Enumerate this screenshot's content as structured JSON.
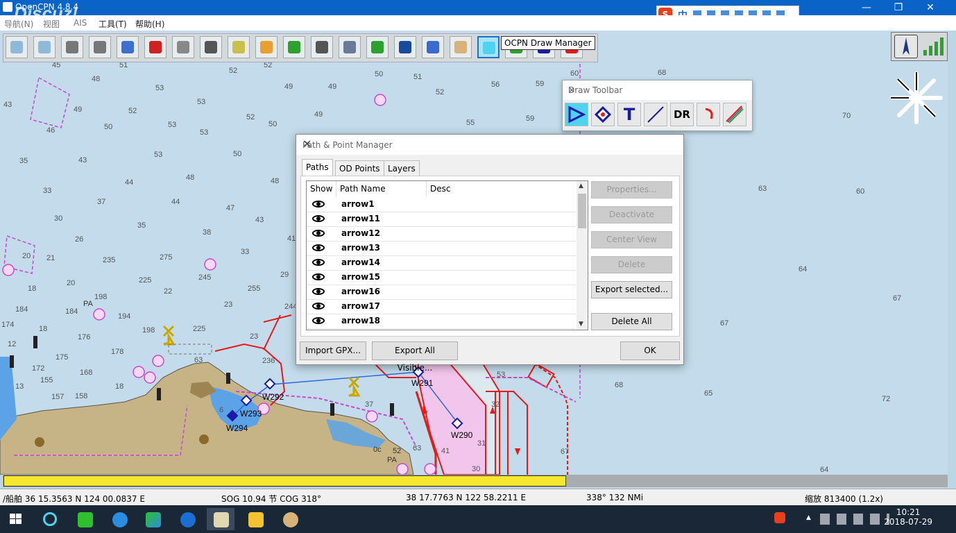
{
  "window": {
    "title": "OpenCPN 4.8.4",
    "watermark": "Discuz!",
    "min_glyph": "—",
    "max_glyph": "❐",
    "close_glyph": "✕"
  },
  "menu": [
    "导航(N)",
    "视图",
    "AIS",
    "工具(T)",
    "帮助(H)"
  ],
  "ime": {
    "logo": "S",
    "lang": "中"
  },
  "tooltip": "OCPN Draw Manager",
  "map_depths": [
    [
      "45",
      75,
      88
    ],
    [
      "51",
      172,
      88
    ],
    [
      "52",
      330,
      96
    ],
    [
      "52",
      380,
      88
    ],
    [
      "50",
      540,
      101
    ],
    [
      "51",
      596,
      105
    ],
    [
      "60",
      822,
      100
    ],
    [
      "68",
      948,
      99
    ],
    [
      "48",
      132,
      108
    ],
    [
      "53",
      224,
      121
    ],
    [
      "49",
      410,
      119
    ],
    [
      "49",
      473,
      119
    ],
    [
      "52",
      628,
      127
    ],
    [
      "56",
      708,
      116
    ],
    [
      "59",
      772,
      115
    ],
    [
      "43",
      5,
      145
    ],
    [
      "49",
      106,
      152
    ],
    [
      "53",
      284,
      141
    ],
    [
      "52",
      185,
      154
    ],
    [
      "52",
      355,
      163
    ],
    [
      "49",
      453,
      159
    ],
    [
      "50",
      387,
      173
    ],
    [
      "50",
      150,
      177
    ],
    [
      "53",
      242,
      174
    ],
    [
      "46",
      67,
      182
    ],
    [
      "53",
      288,
      185
    ],
    [
      "55",
      672,
      171
    ],
    [
      "59",
      758,
      165
    ],
    [
      "70",
      1214,
      161
    ],
    [
      "35",
      28,
      226
    ],
    [
      "43",
      113,
      225
    ],
    [
      "53",
      222,
      217
    ],
    [
      "50",
      336,
      216
    ],
    [
      "44",
      180,
      257
    ],
    [
      "48",
      268,
      250
    ],
    [
      "48",
      390,
      255
    ],
    [
      "33",
      62,
      269
    ],
    [
      "37",
      140,
      285
    ],
    [
      "44",
      247,
      285
    ],
    [
      "47",
      326,
      294
    ],
    [
      "63",
      1093,
      266
    ],
    [
      "60",
      1234,
      270
    ],
    [
      "30",
      78,
      309
    ],
    [
      "35",
      198,
      319
    ],
    [
      "43",
      368,
      311
    ],
    [
      "38",
      292,
      329
    ],
    [
      "41",
      414,
      338
    ],
    [
      "26",
      108,
      339
    ],
    [
      "20",
      32,
      363
    ],
    [
      "21",
      67,
      366
    ],
    [
      "235",
      148,
      369
    ],
    [
      "275",
      230,
      365
    ],
    [
      "33",
      347,
      357
    ],
    [
      "64",
      1151,
      382
    ],
    [
      "20",
      96,
      402
    ],
    [
      "225",
      200,
      398
    ],
    [
      "245",
      286,
      394
    ],
    [
      "29",
      404,
      390
    ],
    [
      "18",
      40,
      410
    ],
    [
      "22",
      236,
      414
    ],
    [
      "255",
      357,
      410
    ],
    [
      "198",
      136,
      422
    ],
    [
      "23",
      323,
      433
    ],
    [
      "244",
      410,
      436
    ],
    [
      "67",
      1287,
      424
    ],
    [
      "184",
      22,
      440
    ],
    [
      "184",
      94,
      443
    ],
    [
      "194",
      170,
      450
    ],
    [
      "198",
      205,
      470
    ],
    [
      "225",
      278,
      468
    ],
    [
      "174",
      2,
      462
    ],
    [
      "18",
      56,
      468
    ],
    [
      "176",
      112,
      480
    ],
    [
      "23",
      360,
      479
    ],
    [
      "67",
      1038,
      460
    ],
    [
      "12",
      11,
      490
    ],
    [
      "175",
      80,
      509
    ],
    [
      "178",
      160,
      501
    ],
    [
      "63",
      280,
      513
    ],
    [
      "172",
      46,
      525
    ],
    [
      "168",
      115,
      531
    ],
    [
      "18",
      166,
      551
    ],
    [
      "236",
      378,
      514
    ],
    [
      "155",
      58,
      542
    ],
    [
      "53",
      716,
      534
    ],
    [
      "68",
      886,
      549
    ],
    [
      "13",
      22,
      551
    ],
    [
      "157",
      74,
      566
    ],
    [
      "158",
      108,
      565
    ],
    [
      "6",
      316,
      585
    ],
    [
      "37",
      526,
      577
    ],
    [
      "65",
      1015,
      561
    ],
    [
      "72",
      1271,
      569
    ],
    [
      "63",
      595,
      640
    ],
    [
      "31",
      688,
      633
    ],
    [
      "67",
      808,
      645
    ],
    [
      "64",
      1182,
      671
    ]
  ],
  "map_labels": {
    "pa1": "PA",
    "pa2": "PA",
    "w292": "W292",
    "w293": "W293",
    "w294": "W294",
    "w291": "W291",
    "w290": "W290",
    "oc": "0c",
    "n52": "52",
    "n30": "30",
    "n32": "32",
    "n31": "31",
    "n41": "41",
    "n1": "1"
  },
  "draw_toolbar": {
    "title": "Draw Toolbar",
    "close": "✕",
    "buttons": [
      "",
      "",
      "T",
      "",
      "DR",
      "",
      ""
    ]
  },
  "dialog": {
    "title": "Path & Point Manager",
    "close": "✕",
    "tabs": [
      "Paths",
      "OD Points",
      "Layers"
    ],
    "columns": [
      "Show",
      "Path Name",
      "Desc"
    ],
    "rows": [
      "arrow1",
      "arrow11",
      "arrow12",
      "arrow13",
      "arrow14",
      "arrow15",
      "arrow16",
      "arrow17",
      "arrow18"
    ],
    "side_buttons": [
      {
        "label": "Properties...",
        "enabled": false
      },
      {
        "label": "Deactivate",
        "enabled": false
      },
      {
        "label": "Center View",
        "enabled": false
      },
      {
        "label": "Delete",
        "enabled": false
      },
      {
        "label": "Export selected...",
        "enabled": true
      },
      {
        "label": "Delete All",
        "enabled": true
      }
    ],
    "bottom": {
      "import": "Import GPX...",
      "export": "Export All Visible...",
      "ok": "OK"
    },
    "scroll_up": "▲",
    "scroll_down": "▼"
  },
  "progress": {
    "fraction": 0.596,
    "color": "#f5e630"
  },
  "status": {
    "ship": "/船舶 36 15.3563 N    124 00.0837 E",
    "sog": "SOG 10.94 节  COG 318°",
    "cursor": "38 17.7763 N    122 58.2211 E",
    "bearing": "338°  132 NMi",
    "scale": "缩放 813400 (1.2x)"
  },
  "taskbar": {
    "apps": [
      "windows-logo",
      "search",
      "iqiyi",
      "ie",
      "media-player",
      "sogou",
      "opencpn",
      "file-explorer",
      "paint"
    ],
    "time": "10:21",
    "date": "2018-07-29",
    "tray_up": "▲"
  },
  "colors": {
    "land": "#c7b486",
    "water": "#c3dbea",
    "shallow": "#5ba3e6",
    "route": "#e41b1b",
    "magenta": "#c44ad0"
  }
}
